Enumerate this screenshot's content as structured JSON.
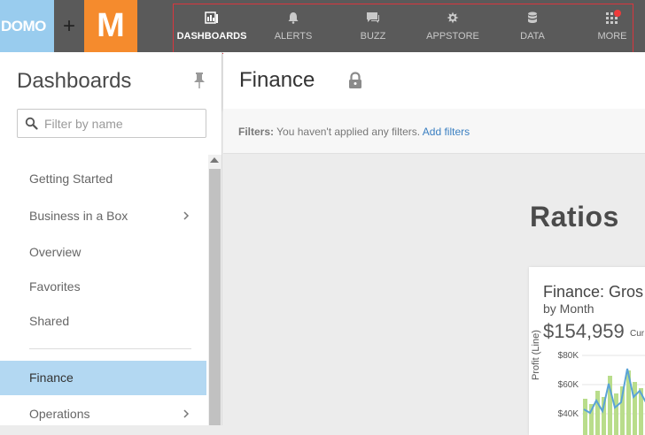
{
  "topbar": {
    "brand_left": "DOMO",
    "plus": "+",
    "brand_right": "M",
    "nav": [
      {
        "label": "DASHBOARDS",
        "icon": "dashboards-icon",
        "active": true
      },
      {
        "label": "ALERTS",
        "icon": "bell-icon",
        "active": false
      },
      {
        "label": "BUZZ",
        "icon": "chat-icon",
        "active": false
      },
      {
        "label": "APPSTORE",
        "icon": "appstore-icon",
        "active": false
      },
      {
        "label": "DATA",
        "icon": "database-icon",
        "active": false
      },
      {
        "label": "MORE",
        "icon": "grid-icon",
        "active": false,
        "badge": true
      }
    ]
  },
  "sidebar": {
    "title": "Dashboards",
    "filter_placeholder": "Filter by name",
    "items": [
      {
        "label": "Getting Started",
        "has_children": false
      },
      {
        "label": "Business in a Box",
        "has_children": true
      },
      {
        "label": "Overview",
        "has_children": false
      },
      {
        "label": "Favorites",
        "has_children": false
      },
      {
        "label": "Shared",
        "has_children": false
      },
      {
        "label": "Finance",
        "has_children": false,
        "active": true
      },
      {
        "label": "Operations",
        "has_children": true
      }
    ]
  },
  "page": {
    "title": "Finance",
    "filters_label": "Filters:",
    "filters_text": "You haven't applied any filters.",
    "add_filters": "Add filters"
  },
  "section": {
    "title": "Ratios"
  },
  "card": {
    "title": "Finance: Gros",
    "subtitle": "by Month",
    "value": "$154,959",
    "value_suffix": "Cur",
    "ylabel": "Profit (Line)",
    "yticks": [
      "$80K",
      "$60K",
      "$40K"
    ]
  },
  "colors": {
    "topbar": "#5a5a5a",
    "domo_blue": "#99ccee",
    "m_orange": "#f58b2d",
    "nav_highlight": "#d9363e",
    "active_item": "#b3d8f2",
    "link": "#3a7fc1"
  }
}
